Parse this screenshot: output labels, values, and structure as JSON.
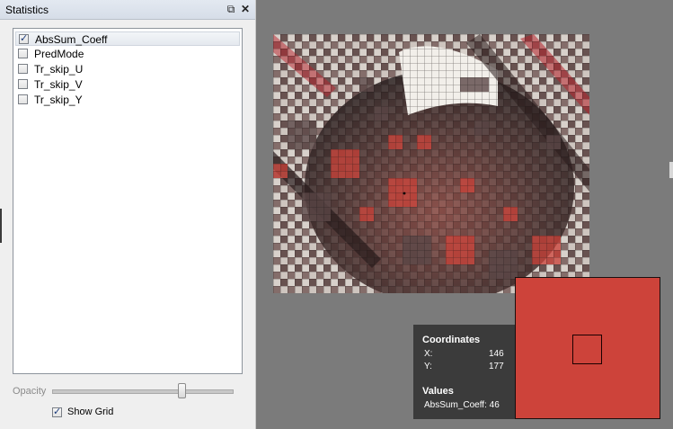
{
  "dock": {
    "title": "Statistics",
    "float_icon": "float-window-icon",
    "close_icon": "close-icon",
    "items": [
      {
        "label": "AbsSum_Coeff",
        "checked": true,
        "selected": true
      },
      {
        "label": "PredMode",
        "checked": false,
        "selected": false
      },
      {
        "label": "Tr_skip_U",
        "checked": false,
        "selected": false
      },
      {
        "label": "Tr_skip_V",
        "checked": false,
        "selected": false
      },
      {
        "label": "Tr_skip_Y",
        "checked": false,
        "selected": false
      }
    ],
    "opacity_label": "Opacity",
    "opacity_value": 0.72,
    "show_grid_label": "Show Grid",
    "show_grid_checked": true
  },
  "info": {
    "coordinates_heading": "Coordinates",
    "x_label": "X:",
    "x_value": "146",
    "y_label": "Y:",
    "y_value": "177",
    "values_heading": "Values",
    "value_text": "AbsSum_Coeff: 46"
  },
  "colors": {
    "background": "#7b7b7b",
    "overlay_red": "#cd433a",
    "info_panel": "#3b3b3b"
  }
}
